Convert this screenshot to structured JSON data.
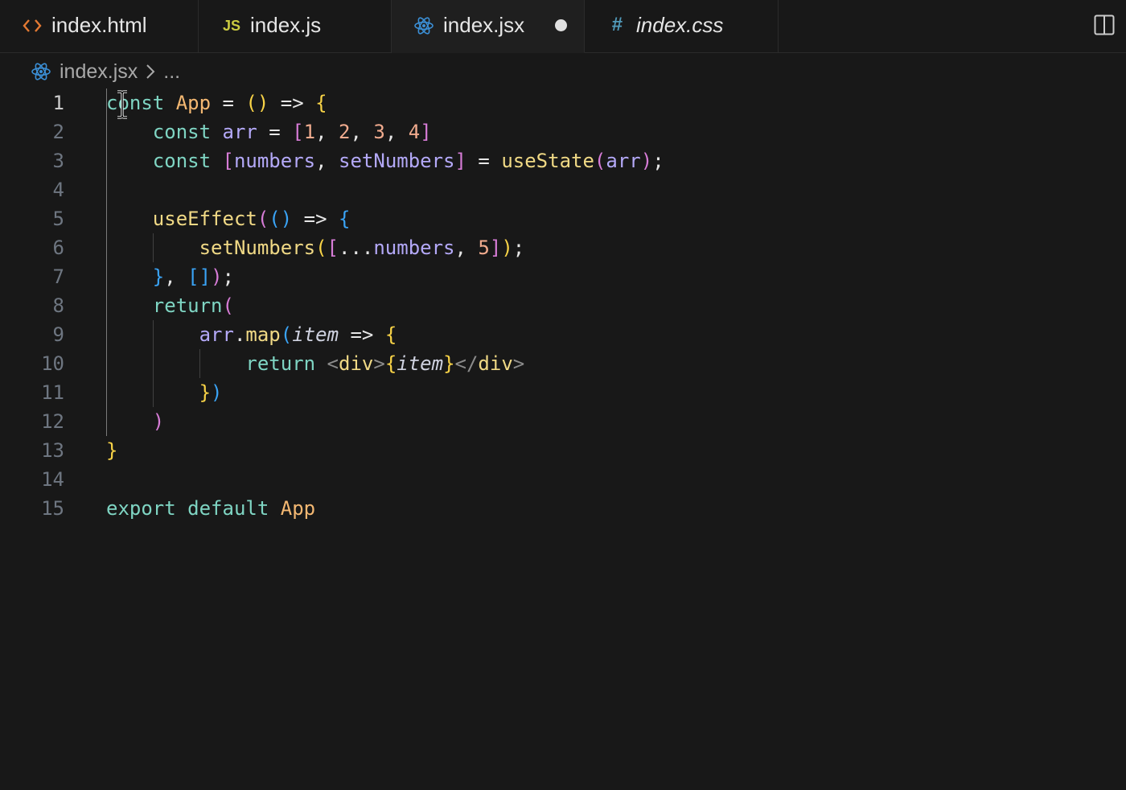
{
  "tabs": [
    {
      "label": "index.html",
      "icon": "html-file-icon",
      "icon_text": "<>",
      "active": false,
      "italic": false
    },
    {
      "label": "index.js",
      "icon": "js-file-icon",
      "icon_text": "JS",
      "active": false,
      "italic": false
    },
    {
      "label": "index.jsx",
      "icon": "react-file-icon",
      "icon_text": "",
      "active": true,
      "dirty": true,
      "italic": false
    },
    {
      "label": "index.css",
      "icon": "css-file-icon",
      "icon_text": "#",
      "active": false,
      "italic": true
    }
  ],
  "breadcrumb": {
    "file": "index.jsx",
    "more": "..."
  },
  "line_numbers": [
    "1",
    "2",
    "3",
    "4",
    "5",
    "6",
    "7",
    "8",
    "9",
    "10",
    "11",
    "12",
    "13",
    "14",
    "15"
  ],
  "current_line": 1,
  "code_lines": [
    [
      [
        "kw",
        "const"
      ],
      [
        "op",
        " "
      ],
      [
        "cls",
        "App"
      ],
      [
        "op",
        " = "
      ],
      [
        "b1",
        "()"
      ],
      [
        "op",
        " => "
      ],
      [
        "b1",
        "{"
      ]
    ],
    [
      [
        "op",
        "    "
      ],
      [
        "kw",
        "const"
      ],
      [
        "op",
        " "
      ],
      [
        "var",
        "arr"
      ],
      [
        "op",
        " = "
      ],
      [
        "b2",
        "["
      ],
      [
        "num",
        "1"
      ],
      [
        "pu",
        ", "
      ],
      [
        "num",
        "2"
      ],
      [
        "pu",
        ", "
      ],
      [
        "num",
        "3"
      ],
      [
        "pu",
        ", "
      ],
      [
        "num",
        "4"
      ],
      [
        "b2",
        "]"
      ]
    ],
    [
      [
        "op",
        "    "
      ],
      [
        "kw",
        "const"
      ],
      [
        "op",
        " "
      ],
      [
        "b2",
        "["
      ],
      [
        "var",
        "numbers"
      ],
      [
        "pu",
        ", "
      ],
      [
        "var",
        "setNumbers"
      ],
      [
        "b2",
        "]"
      ],
      [
        "op",
        " = "
      ],
      [
        "fn",
        "useState"
      ],
      [
        "b2",
        "("
      ],
      [
        "var",
        "arr"
      ],
      [
        "b2",
        ")"
      ],
      [
        "pu",
        ";"
      ]
    ],
    [],
    [
      [
        "op",
        "    "
      ],
      [
        "fn",
        "useEffect"
      ],
      [
        "b2",
        "("
      ],
      [
        "b3",
        "()"
      ],
      [
        "op",
        " => "
      ],
      [
        "b3",
        "{"
      ]
    ],
    [
      [
        "op",
        "        "
      ],
      [
        "fn",
        "setNumbers"
      ],
      [
        "b1",
        "("
      ],
      [
        "b2",
        "["
      ],
      [
        "pu",
        "..."
      ],
      [
        "var",
        "numbers"
      ],
      [
        "pu",
        ", "
      ],
      [
        "num",
        "5"
      ],
      [
        "b2",
        "]"
      ],
      [
        "b1",
        ")"
      ],
      [
        "pu",
        ";"
      ]
    ],
    [
      [
        "op",
        "    "
      ],
      [
        "b3",
        "}"
      ],
      [
        "pu",
        ", "
      ],
      [
        "b3",
        "[]"
      ],
      [
        "b2",
        ")"
      ],
      [
        "pu",
        ";"
      ]
    ],
    [
      [
        "op",
        "    "
      ],
      [
        "kw",
        "return"
      ],
      [
        "b2",
        "("
      ]
    ],
    [
      [
        "op",
        "        "
      ],
      [
        "var",
        "arr"
      ],
      [
        "pu",
        "."
      ],
      [
        "fn",
        "map"
      ],
      [
        "b3",
        "("
      ],
      [
        "it",
        "item"
      ],
      [
        "op",
        " => "
      ],
      [
        "b1",
        "{"
      ]
    ],
    [
      [
        "op",
        "            "
      ],
      [
        "kw",
        "return"
      ],
      [
        "op",
        " "
      ],
      [
        "tagp",
        "<"
      ],
      [
        "tag",
        "div"
      ],
      [
        "tagp",
        ">"
      ],
      [
        "b1",
        "{"
      ],
      [
        "it",
        "item"
      ],
      [
        "b1",
        "}"
      ],
      [
        "tagp",
        "</"
      ],
      [
        "tag",
        "div"
      ],
      [
        "tagp",
        ">"
      ]
    ],
    [
      [
        "op",
        "        "
      ],
      [
        "b1",
        "}"
      ],
      [
        "b3",
        ")"
      ]
    ],
    [
      [
        "op",
        "    "
      ],
      [
        "b2",
        ")"
      ]
    ],
    [
      [
        "b1",
        "}"
      ]
    ],
    [],
    [
      [
        "kw",
        "export"
      ],
      [
        "op",
        " "
      ],
      [
        "kw",
        "default"
      ],
      [
        "op",
        " "
      ],
      [
        "cls",
        "App"
      ]
    ]
  ],
  "colors": {
    "background": "#181818",
    "keyword": "#7fd5c3",
    "function": "#f0d985",
    "variable": "#b4a9f8",
    "number": "#f1ab8e",
    "bracket_gold": "#f8d347",
    "bracket_magenta": "#d77cd7",
    "bracket_blue": "#3aa3f5"
  }
}
